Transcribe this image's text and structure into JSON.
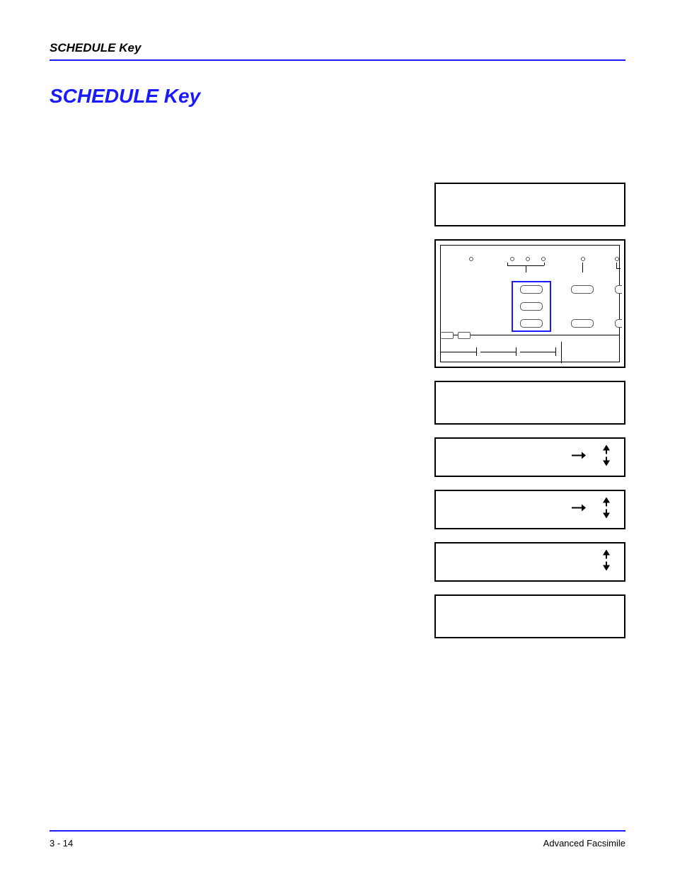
{
  "header": {
    "running_head": "SCHEDULE Key"
  },
  "title": "SCHEDULE Key",
  "footer": {
    "page": "3 - 14",
    "book": "Advanced Facsimile"
  }
}
